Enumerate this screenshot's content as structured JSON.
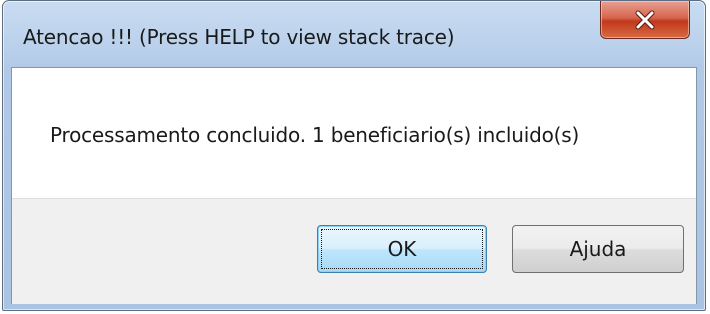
{
  "dialog": {
    "title": "Atencao !!!  (Press HELP to view stack trace)",
    "message": "Processamento concluido. 1  beneficiario(s) incluido(s)",
    "buttons": {
      "ok_label": "OK",
      "help_label": "Ajuda"
    },
    "close_icon": "close-x-icon"
  },
  "colors": {
    "title_bar": "#bcd2ec",
    "close_button": "#c7452a",
    "button_area": "#f0f0f0",
    "ok_focus_border": "#3c7fb1"
  }
}
